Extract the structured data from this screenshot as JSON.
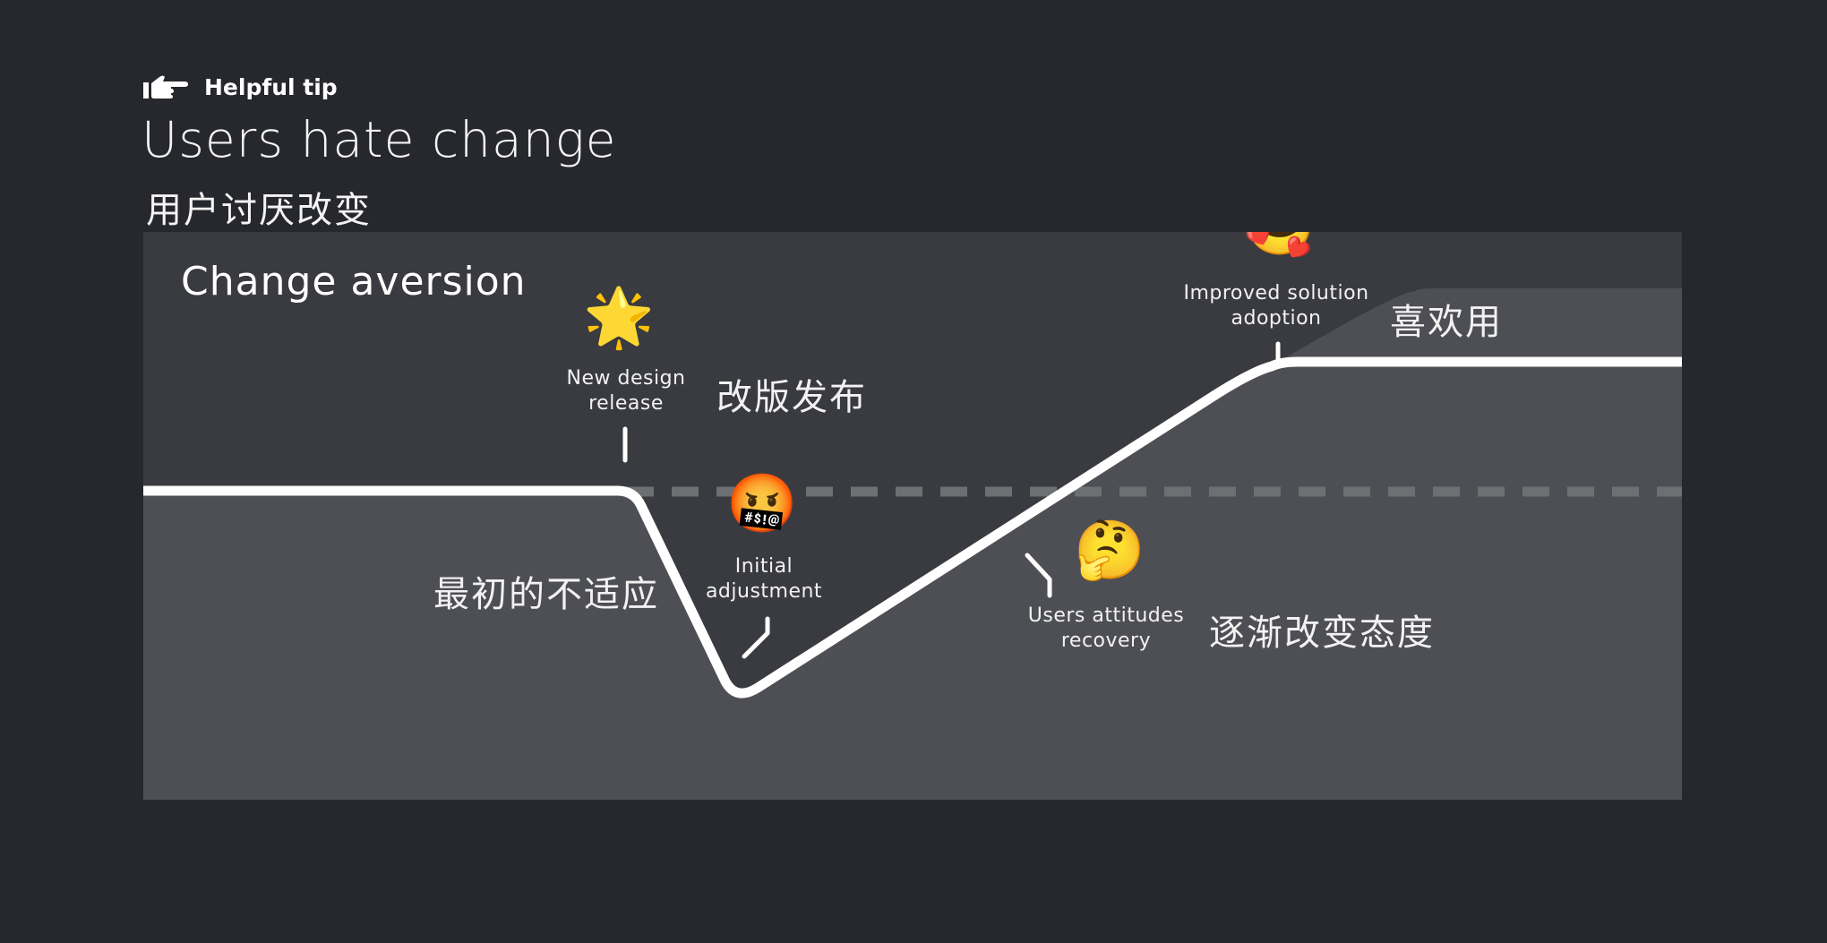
{
  "header": {
    "tip_icon": "pointing-hand-icon",
    "tip_label": "Helpful tip",
    "title": "Users hate change",
    "subtitle_zh": "用户讨厌改变"
  },
  "diagram": {
    "title": "Change aversion",
    "colors": {
      "page_background": "#27282d",
      "panel_upper": "#3a3b40",
      "panel_lower": "#4e4f54",
      "curve": "#ffffff",
      "baseline_dash": "#6e6f73"
    },
    "baseline": "dashed reference line at pre-change satisfaction level",
    "curve_stages": [
      "baseline",
      "drop",
      "trough",
      "recovery",
      "plateau-above-baseline"
    ],
    "annotations": [
      {
        "id": "new-design-release",
        "emoji_name": "glowing-star-icon",
        "emoji": "🌟",
        "label": "New design\nrelease",
        "label_zh": "改版发布"
      },
      {
        "id": "initial-adjustment",
        "emoji_name": "cursing-face-icon",
        "emoji": "🤬",
        "label": "Initial\nadjustment",
        "label_zh": "最初的不适应"
      },
      {
        "id": "users-attitudes-recovery",
        "emoji_name": "thinking-face-icon",
        "emoji": "🤔",
        "label": "Users attitudes\nrecovery",
        "label_zh": "逐渐改变态度"
      },
      {
        "id": "improved-solution-adoption",
        "emoji_name": "smiling-face-with-hearts-icon",
        "emoji": "🥰",
        "label": "Improved solution\nadoption",
        "label_zh": "喜欢用"
      }
    ]
  }
}
